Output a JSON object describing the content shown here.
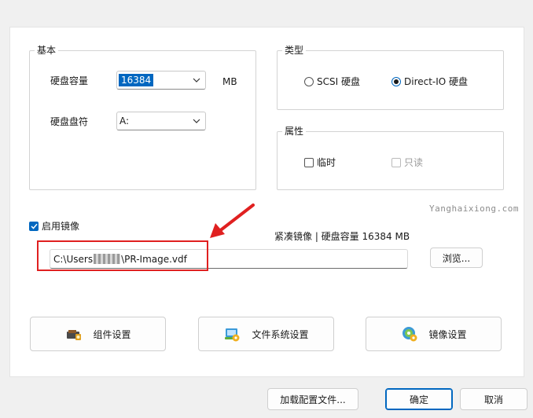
{
  "basic": {
    "title": "基本",
    "capacity_label": "硬盘容量",
    "capacity_value": "16384",
    "capacity_unit": "MB",
    "drive_letter_label": "硬盘盘符",
    "drive_letter_value": "A:"
  },
  "type": {
    "title": "类型",
    "options": [
      {
        "label": "SCSI 硬盘",
        "selected": false
      },
      {
        "label": "Direct-IO 硬盘",
        "selected": true
      }
    ]
  },
  "attributes": {
    "title": "属性",
    "temporary_label": "临时",
    "readonly_label": "只读"
  },
  "watermark": "Yanghaixiong.com",
  "image": {
    "enable_label": "启用镜像",
    "enabled": true,
    "info": "紧凑镜像 | 硬盘容量 16384 MB",
    "path_prefix": "C:\\Users",
    "path_suffix": "\\PR-Image.vdf",
    "browse_label": "浏览..."
  },
  "buttons": {
    "component": "组件设置",
    "filesystem": "文件系统设置",
    "image": "镜像设置"
  },
  "footer": {
    "load_config": "加载配置文件...",
    "ok": "确定",
    "cancel": "取消"
  },
  "colors": {
    "accent": "#0067c0",
    "highlight": "#e02020"
  }
}
